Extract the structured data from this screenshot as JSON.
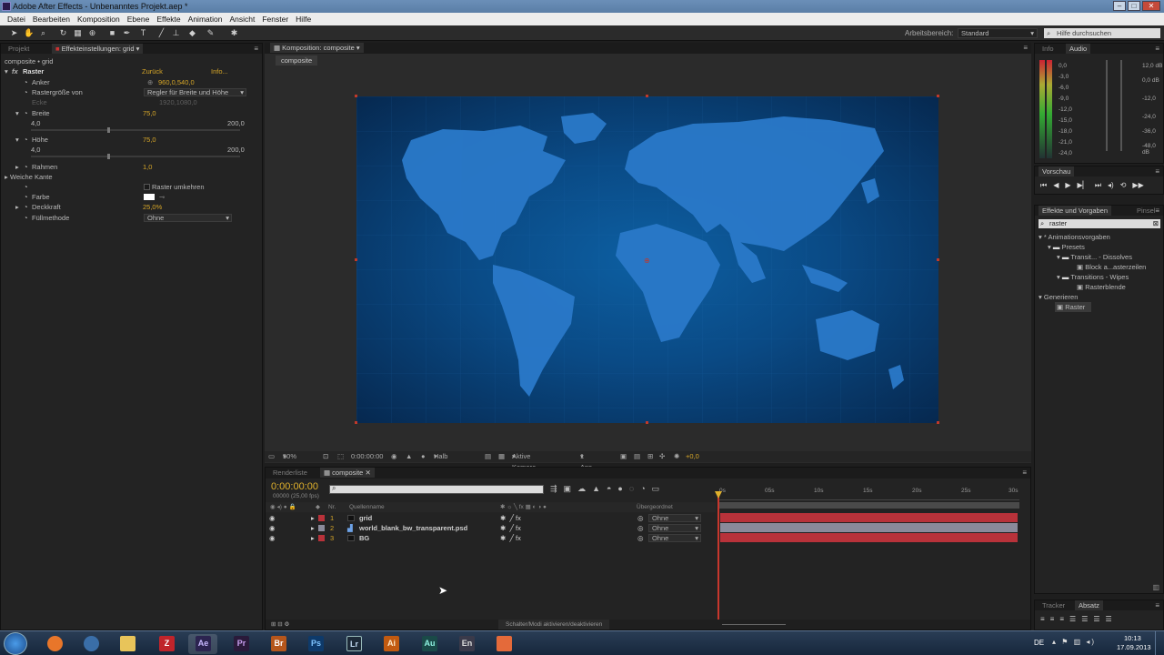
{
  "window": {
    "title": "Adobe After Effects - Unbenanntes Projekt.aep *"
  },
  "menu": [
    "Datei",
    "Bearbeiten",
    "Komposition",
    "Ebene",
    "Effekte",
    "Animation",
    "Ansicht",
    "Fenster",
    "Hilfe"
  ],
  "toolbar": {
    "workspace_label": "Arbeitsbereich:",
    "workspace_value": "Standard",
    "help_placeholder": "Hilfe durchsuchen"
  },
  "left_panel": {
    "tab_project": "Projekt",
    "tab_effects": "Effekteinstellungen: grid",
    "breadcrumb": "composite • grid",
    "effect_name": "Raster",
    "reset": "Zurück",
    "info": "Info...",
    "props": {
      "anker": {
        "label": "Anker",
        "value": "960,0,540,0"
      },
      "rastergroesse": {
        "label": "Rastergröße von",
        "value": "Regler für Breite und Höhe"
      },
      "ecke": {
        "label": "Ecke",
        "value": "1920,1080,0"
      },
      "breite": {
        "label": "Breite",
        "value": "75,0",
        "min": "4,0",
        "max": "200,0"
      },
      "hoehe": {
        "label": "Höhe",
        "value": "75,0",
        "min": "4,0",
        "max": "200,0"
      },
      "rahmen": {
        "label": "Rahmen",
        "value": "1,0"
      },
      "weiche_kante": {
        "label": "Weiche Kante"
      },
      "umkehren": {
        "label": "Raster umkehren"
      },
      "farbe": {
        "label": "Farbe"
      },
      "deckkraft": {
        "label": "Deckkraft",
        "value": "25,0%"
      },
      "fuellmethode": {
        "label": "Füllmethode",
        "value": "Ohne"
      }
    }
  },
  "viewer": {
    "tab": "Komposition: composite",
    "comp_tab": "composite",
    "zoom": "50%",
    "timecode": "0:00:00:00",
    "resolution": "Halb",
    "camera": "Aktive Kamera",
    "views": "1 Ans...",
    "exposure": "+0,0"
  },
  "timeline": {
    "tab_render": "Renderliste",
    "tab_comp": "composite",
    "timecode": "0:00:00:00",
    "fps": "00000 (25,00 fps)",
    "col_nr": "Nr.",
    "col_source": "Quellenname",
    "col_parent": "Übergeordnet",
    "ruler": [
      "0s",
      "05s",
      "10s",
      "15s",
      "20s",
      "25s",
      "30s"
    ],
    "layers": [
      {
        "nr": "1",
        "name": "grid",
        "parent": "Ohne"
      },
      {
        "nr": "2",
        "name": "world_blank_bw_transparent.psd",
        "parent": "Ohne"
      },
      {
        "nr": "3",
        "name": "BG",
        "parent": "Ohne"
      }
    ],
    "footer": "Schalter/Modi aktivieren/deaktivieren"
  },
  "right_panel": {
    "tab_info": "Info",
    "tab_audio": "Audio",
    "meter_left": [
      "0,0",
      "-3,0",
      "-6,0",
      "-9,0",
      "-12,0",
      "-15,0",
      "-18,0",
      "-21,0",
      "-24,0"
    ],
    "meter_right": [
      "12,0 dB",
      "0,0 dB",
      "-12,0",
      "-24,0",
      "-36,0",
      "-48,0 dB"
    ],
    "tab_preview": "Vorschau",
    "tab_effects": "Effekte und Vorgaben",
    "tab_paint": "Pinsel",
    "search": "raster",
    "tree": [
      "* Animationsvorgaben",
      "Presets",
      "Transit... - Dissolves",
      "Block a...asterzeilen",
      "Transitions - Wipes",
      "Rasterblende",
      "Generieren",
      "Raster"
    ],
    "tab_tracker": "Tracker",
    "tab_absatz": "Absatz"
  },
  "taskbar": {
    "apps": [
      "Ae",
      "Pr",
      "Br",
      "Ps",
      "Lr",
      "Ai",
      "Au",
      "En"
    ],
    "lang": "DE",
    "time": "10:13",
    "date": "17.09.2013"
  },
  "colors": {
    "gold": "#d6a628",
    "layer_red": "#b8323a",
    "layer_gray": "#8a8a9a",
    "map": "#1f6dbf"
  }
}
